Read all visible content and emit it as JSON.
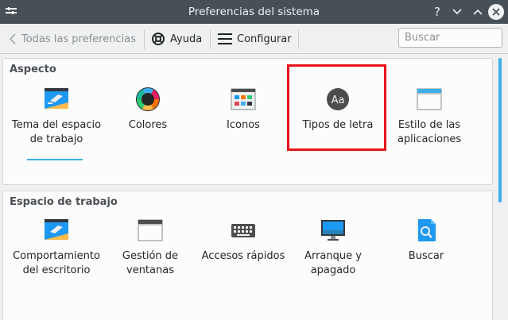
{
  "window": {
    "title": "Preferencias del sistema",
    "help_glyph": "?"
  },
  "toolbar": {
    "back_label": "Todas las preferencias",
    "help_label": "Ayuda",
    "configure_label": "Configurar",
    "search_placeholder": "Buscar"
  },
  "sections": [
    {
      "title": "Aspecto",
      "items": [
        {
          "label": "Tema del espacio de trabajo",
          "icon": "workspace-theme-icon"
        },
        {
          "label": "Colores",
          "icon": "color-wheel-icon"
        },
        {
          "label": "Iconos",
          "icon": "icons-icon"
        },
        {
          "label": "Tipos de letra",
          "icon": "fonts-icon",
          "icon_text": "Aa"
        },
        {
          "label": "Estilo de las aplicaciones",
          "icon": "application-style-icon"
        }
      ]
    },
    {
      "title": "Espacio de trabajo",
      "items": [
        {
          "label": "Comportamiento del escritorio",
          "icon": "desktop-behavior-icon"
        },
        {
          "label": "Gestión de ventanas",
          "icon": "window-management-icon"
        },
        {
          "label": "Accesos rápidos",
          "icon": "keyboard-icon"
        },
        {
          "label": "Arranque y apagado",
          "icon": "startup-shutdown-icon"
        },
        {
          "label": "Buscar",
          "icon": "search-icon"
        }
      ]
    }
  ],
  "colors": {
    "titlebar": "#475057",
    "accent": "#3daee9",
    "highlight": "#e8131a"
  }
}
